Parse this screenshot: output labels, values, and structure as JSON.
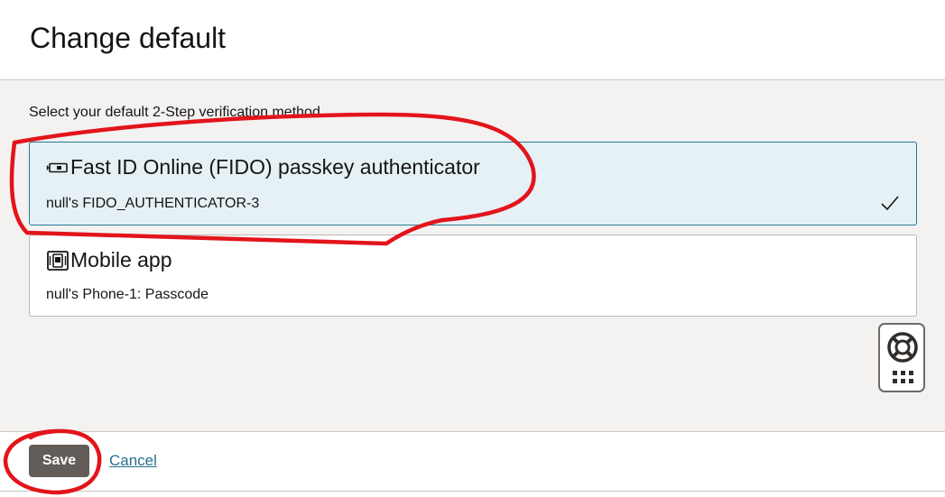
{
  "header": {
    "title": "Change default"
  },
  "main": {
    "instruction": "Select your default 2-Step verification method",
    "options": [
      {
        "title": "Fast ID Online (FIDO) passkey authenticator",
        "subtitle": "null's FIDO_AUTHENTICATOR-3",
        "icon": "security-key-icon",
        "selected": true
      },
      {
        "title": "Mobile app",
        "subtitle": "null's Phone-1: Passcode",
        "icon": "mobile-app-icon",
        "selected": false
      }
    ]
  },
  "help_widget": {
    "icons": [
      "lifebuoy-icon",
      "app-grid-icon"
    ]
  },
  "footer": {
    "save_label": "Save",
    "cancel_label": "Cancel"
  },
  "colors": {
    "selected_background": "#e6f1f5",
    "selected_border": "#227a9a",
    "primary_button": "#625d59",
    "link": "#2a6f8f",
    "annotation": "#e3141b"
  }
}
